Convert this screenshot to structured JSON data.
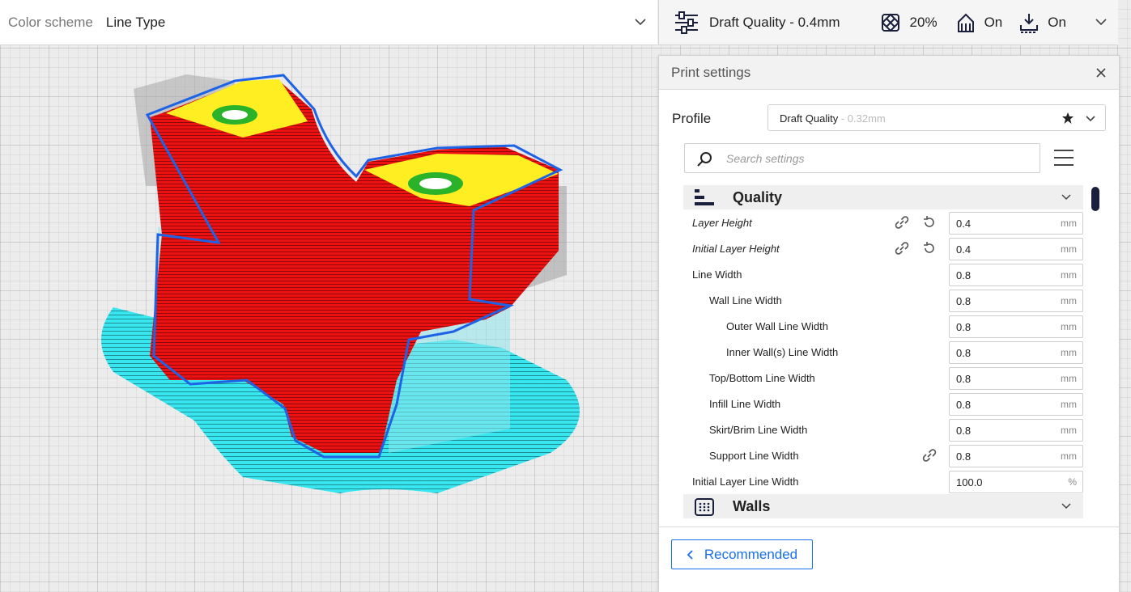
{
  "color_scheme": {
    "label": "Color scheme",
    "value": "Line Type"
  },
  "print_setup": {
    "profile": "Draft Quality - 0.4mm",
    "infill": "20%",
    "support": "On",
    "adhesion": "On"
  },
  "panel": {
    "title": "Print settings",
    "profile_label": "Profile",
    "profile_name": "Draft Quality",
    "profile_sub": " - 0.32mm",
    "search_placeholder": "Search settings",
    "categories": [
      {
        "label": "Quality",
        "icon": "quality-icon"
      },
      {
        "label": "Walls",
        "icon": "walls-icon"
      }
    ],
    "settings": [
      {
        "label": "Layer Height",
        "value": "0.4",
        "unit": "mm"
      },
      {
        "label": "Initial Layer Height",
        "value": "0.4",
        "unit": "mm"
      },
      {
        "label": "Line Width",
        "value": "0.8",
        "unit": "mm"
      },
      {
        "label": "Wall Line Width",
        "value": "0.8",
        "unit": "mm"
      },
      {
        "label": "Outer Wall Line Width",
        "value": "0.8",
        "unit": "mm"
      },
      {
        "label": "Inner Wall(s) Line Width",
        "value": "0.8",
        "unit": "mm"
      },
      {
        "label": "Top/Bottom Line Width",
        "value": "0.8",
        "unit": "mm"
      },
      {
        "label": "Infill Line Width",
        "value": "0.8",
        "unit": "mm"
      },
      {
        "label": "Skirt/Brim Line Width",
        "value": "0.8",
        "unit": "mm"
      },
      {
        "label": "Support Line Width",
        "value": "0.8",
        "unit": "mm"
      },
      {
        "label": "Initial Layer Line Width",
        "value": "100.0",
        "unit": "%"
      }
    ],
    "recommended_label": "Recommended"
  },
  "colors": {
    "wall_outer": "#ff1a1a",
    "wall_inner": "#19e619",
    "top_bottom": "#ffff1a",
    "skirt": "#33ffff",
    "accent": "#196ef0"
  }
}
